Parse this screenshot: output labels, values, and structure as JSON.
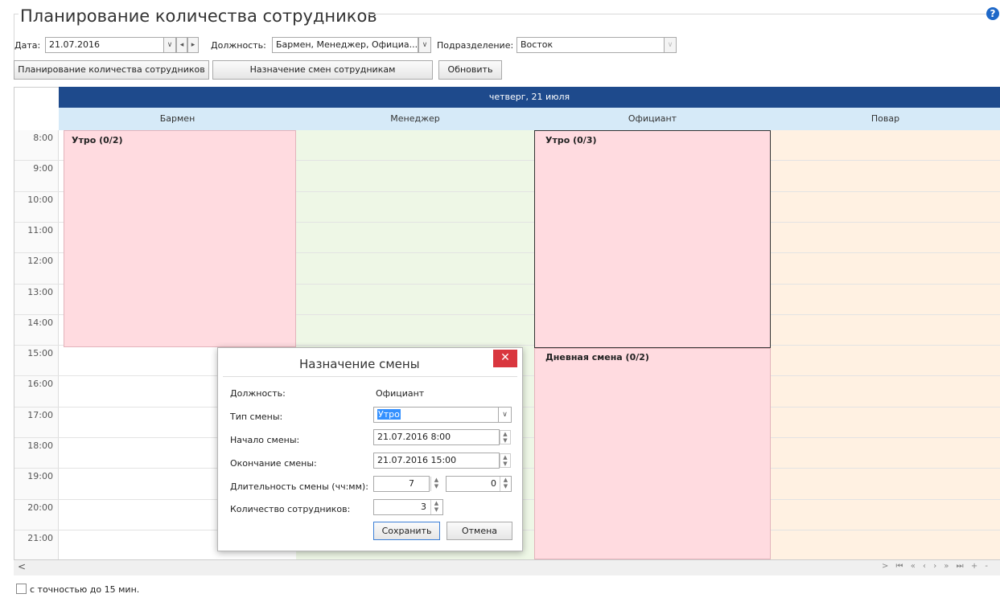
{
  "page": {
    "title": "Планирование количества сотрудников"
  },
  "filters": {
    "date_label": "Дата:",
    "date_value": "21.07.2016",
    "position_label": "Должность:",
    "position_value": "Бармен, Менеджер, Официа...",
    "division_label": "Подразделение:",
    "division_value": "Восток"
  },
  "toolbar": {
    "plan_label": "Планирование количества сотрудников",
    "assign_label": "Назначение смен сотрудникам",
    "refresh_label": "Обновить"
  },
  "calendar": {
    "day_header": "четверг, 21 июля",
    "columns": [
      "Бармен",
      "Менеджер",
      "Официант",
      "Повар"
    ],
    "times": [
      "8:00",
      "9:00",
      "10:00",
      "11:00",
      "12:00",
      "13:00",
      "14:00",
      "15:00",
      "16:00",
      "17:00",
      "18:00",
      "19:00",
      "20:00",
      "21:00"
    ],
    "blocks": {
      "barman_morning": "Утро (0/2)",
      "waiter_morning": "Утро (0/3)",
      "waiter_day": "Дневная смена (0/2)"
    },
    "colors": {
      "day_header": "#1e4a8c",
      "shift_block": "#ffdbe0",
      "manager_bg": "#eef7e6",
      "cook_bg": "#fff1e2"
    }
  },
  "dialog": {
    "title": "Назначение смены",
    "position_label": "Должность:",
    "position_value": "Официант",
    "shift_type_label": "Тип смены:",
    "shift_type_value": "Утро",
    "start_label": "Начало смены:",
    "start_value": "21.07.2016 8:00",
    "end_label": "Окончание смены:",
    "end_value": "21.07.2016 15:00",
    "duration_label": "Длительность смены (чч:мм):",
    "duration_hours": "7",
    "duration_minutes": "0",
    "count_label": "Количество сотрудников:",
    "count_value": "3",
    "save_label": "Сохранить",
    "cancel_label": "Отмена"
  },
  "footer": {
    "precision_label": "с точностью до 15 мин."
  },
  "icons": {
    "help": "question-icon",
    "close": "close-icon",
    "scroll_left": "arrow-left-icon"
  }
}
